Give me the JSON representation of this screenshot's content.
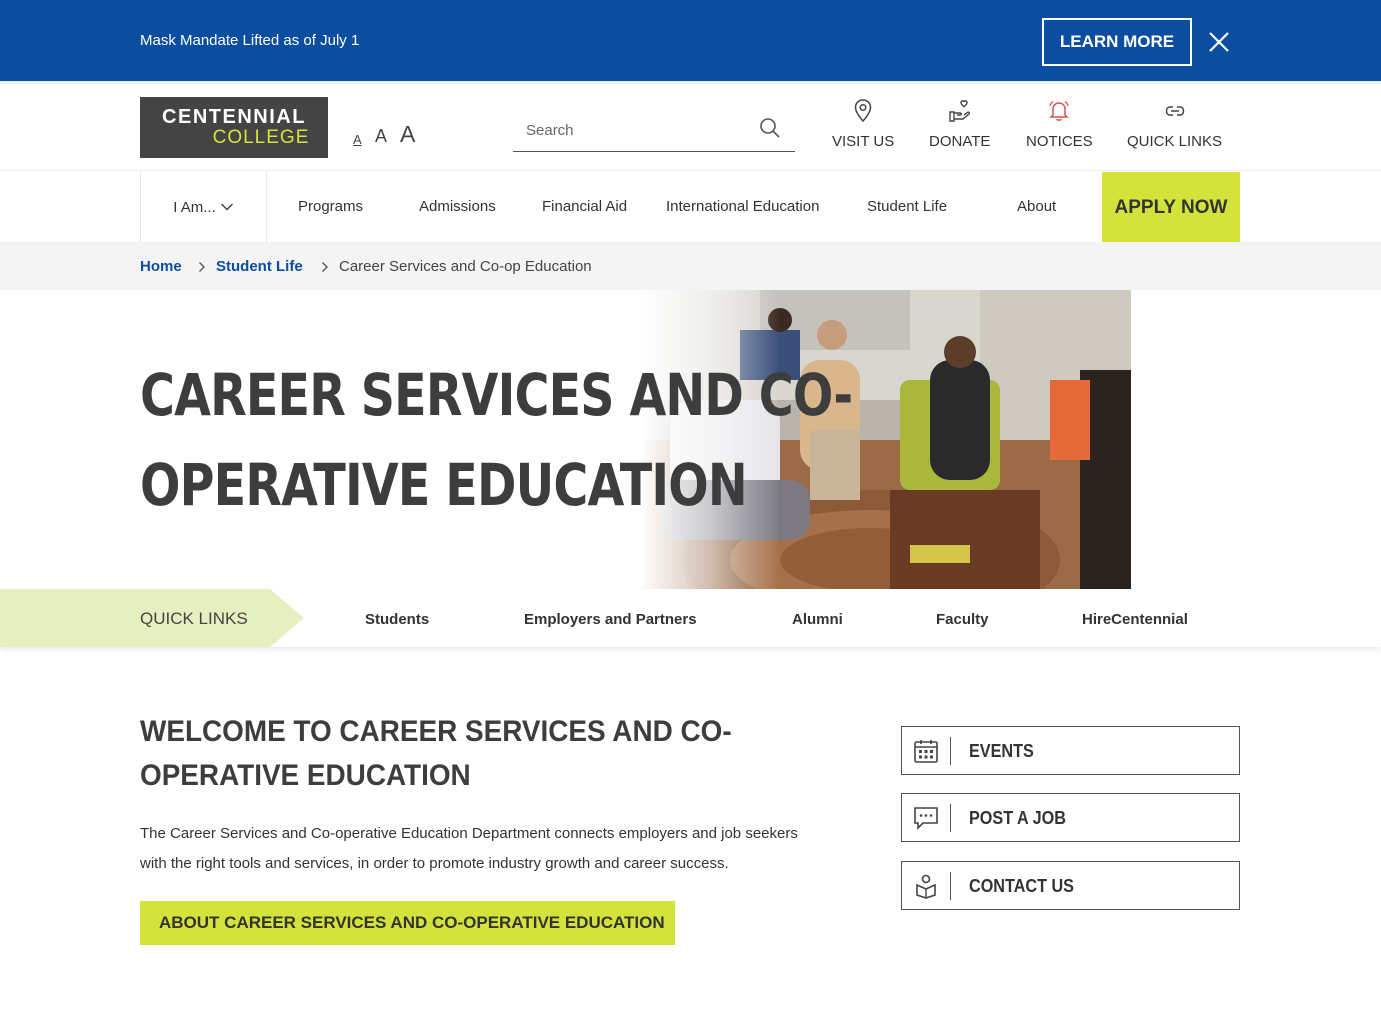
{
  "alert": {
    "text": "Mask Mandate Lifted as of July 1",
    "learn_more": "LEARN MORE"
  },
  "header": {
    "logo_line1": "CENTENNIAL",
    "logo_line2": "COLLEGE",
    "font_small": "A",
    "font_medium": "A",
    "font_large": "A",
    "search_placeholder": "Search",
    "links": {
      "visit": "VISIT US",
      "donate": "DONATE",
      "notices": "NOTICES",
      "quick": "QUICK LINKS"
    }
  },
  "nav": {
    "iam": "I Am...",
    "items": [
      "Programs",
      "Admissions",
      "Financial Aid",
      "International Education",
      "Student Life",
      "About"
    ],
    "apply": "APPLY NOW"
  },
  "breadcrumb": {
    "home": "Home",
    "parent": "Student Life",
    "current": "Career Services and Co-op Education"
  },
  "hero": {
    "title_line1": "CAREER SERVICES AND CO-",
    "title_line2": "OPERATIVE EDUCATION"
  },
  "quick_links": {
    "label": "QUICK LINKS",
    "items": [
      "Students",
      "Employers and Partners",
      "Alumni",
      "Faculty",
      "HireCentennial"
    ]
  },
  "content": {
    "welcome_line1": "WELCOME TO CAREER SERVICES AND CO-",
    "welcome_line2": "OPERATIVE EDUCATION",
    "intro_line1": "The Career Services and Co-operative Education Department connects employers and job seekers",
    "intro_line2": "with the right tools and services, in order to promote industry growth and career success.",
    "cta": "ABOUT CAREER SERVICES AND CO-OPERATIVE EDUCATION"
  },
  "sidebar": {
    "events": "EVENTS",
    "post_job": "POST A JOB",
    "contact": "CONTACT US"
  },
  "colors": {
    "brand_blue": "#0b4d9f",
    "accent_lime": "#d4e23c",
    "notice_red": "#d9534f"
  },
  "icons": [
    "close-icon",
    "search-icon",
    "location-pin-icon",
    "donate-hand-icon",
    "bell-icon",
    "link-icon",
    "chevron-down-icon",
    "chevron-right-icon",
    "arrow-right-icon",
    "calendar-icon",
    "chat-icon",
    "contact-person-icon"
  ]
}
